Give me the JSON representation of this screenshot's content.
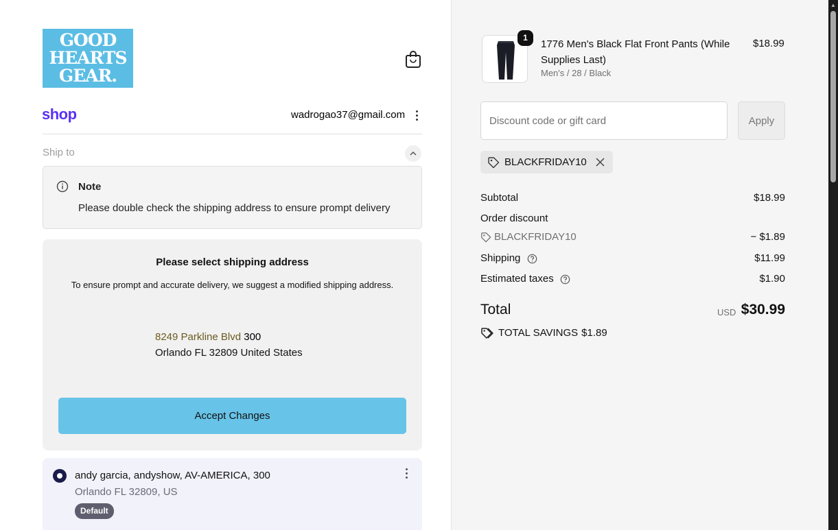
{
  "brand": {
    "logo_lines": [
      "GOOD",
      "HEARTS",
      "GEAR."
    ]
  },
  "header": {
    "shop_label": "shop",
    "email": "wadrogao37@gmail.com"
  },
  "ship_to": {
    "label": "Ship to"
  },
  "note": {
    "title": "Note",
    "text": "Please double check the shipping address to ensure prompt delivery"
  },
  "address_suggestion": {
    "title": "Please select shipping address",
    "subtitle": "To ensure prompt and accurate delivery, we suggest a modified shipping address.",
    "street_highlight": "8249 Parkline Blvd",
    "street_suffix": "300",
    "city_line": "Orlando FL 32809 United States",
    "accept_label": "Accept Changes"
  },
  "saved_address": {
    "name_line": "andy garcia, andyshow, AV-AMERICA, 300",
    "city_line": "Orlando FL 32809, US",
    "badge": "Default"
  },
  "product": {
    "quantity": "1",
    "name": "1776 Men's Black Flat Front Pants (While Supplies Last)",
    "variant": "Men's / 28 / Black",
    "price": "$18.99"
  },
  "discount": {
    "placeholder": "Discount code or gift card",
    "apply_label": "Apply",
    "applied_code": "BLACKFRIDAY10"
  },
  "summary": {
    "subtotal_label": "Subtotal",
    "subtotal_value": "$18.99",
    "order_discount_label": "Order discount",
    "discount_code": "BLACKFRIDAY10",
    "discount_value": "− $1.89",
    "shipping_label": "Shipping",
    "shipping_value": "$11.99",
    "taxes_label": "Estimated taxes",
    "taxes_value": "$1.90",
    "total_label": "Total",
    "total_currency": "USD",
    "total_value": "$30.99",
    "savings_label": "TOTAL SAVINGS",
    "savings_value": "$1.89"
  },
  "colors": {
    "accent_button": "#68c3e8",
    "shop_brand": "#5a31f4",
    "logo_bg": "#5bbde4"
  }
}
